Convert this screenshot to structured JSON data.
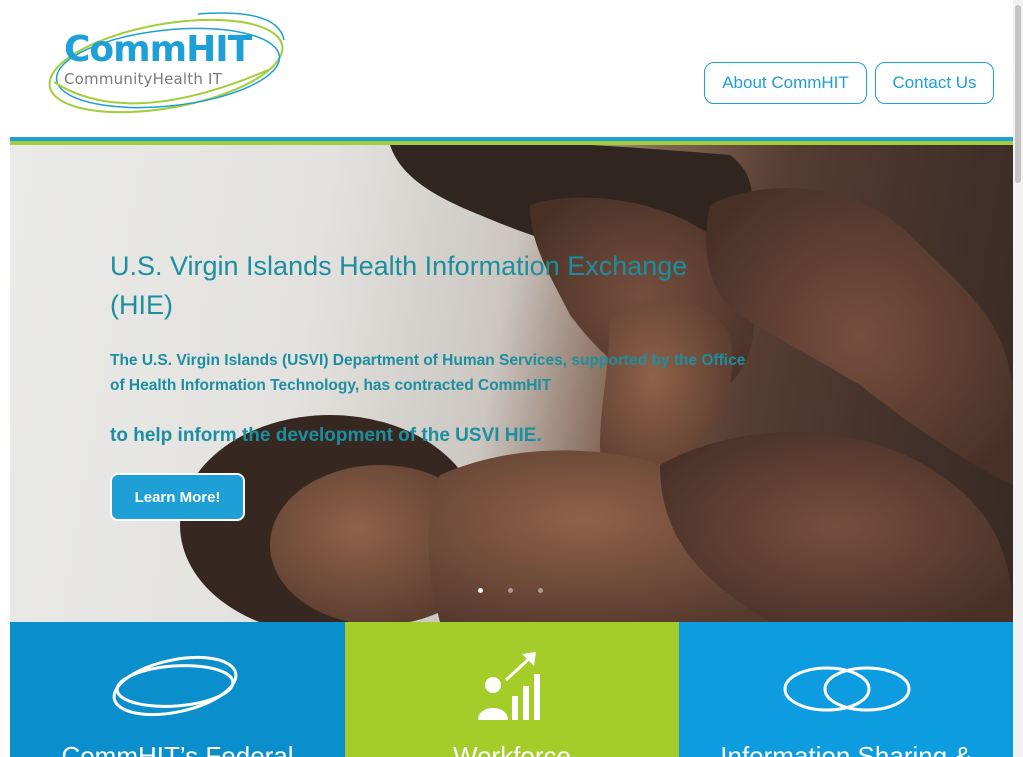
{
  "header": {
    "logo": {
      "main": "CommHIT",
      "sub": "CommunityHealth IT"
    },
    "nav": [
      {
        "label": "About CommHIT"
      },
      {
        "label": "Contact Us"
      }
    ]
  },
  "hero": {
    "title": "U.S. Virgin Islands Health Information Exchange (HIE)",
    "text": "The U.S. Virgin Islands (USVI) Department of Human Services, supported by the Office of Health Information Technology, has contracted CommHIT",
    "text2": "to help inform the development of the USVI HIE.",
    "button": "Learn More!",
    "slides": {
      "count": 3,
      "active": 1
    }
  },
  "tiles": [
    {
      "label": "CommHIT’s Federal",
      "icon": "orbit-rings-icon"
    },
    {
      "label": "Workforce",
      "icon": "growth-chart-icon"
    },
    {
      "label": "Information Sharing &",
      "icon": "linked-rings-icon"
    }
  ],
  "colors": {
    "brand_blue": "#1e9fd6",
    "brand_green": "#a4cd3a",
    "hero_text": "#1b8fa0"
  }
}
